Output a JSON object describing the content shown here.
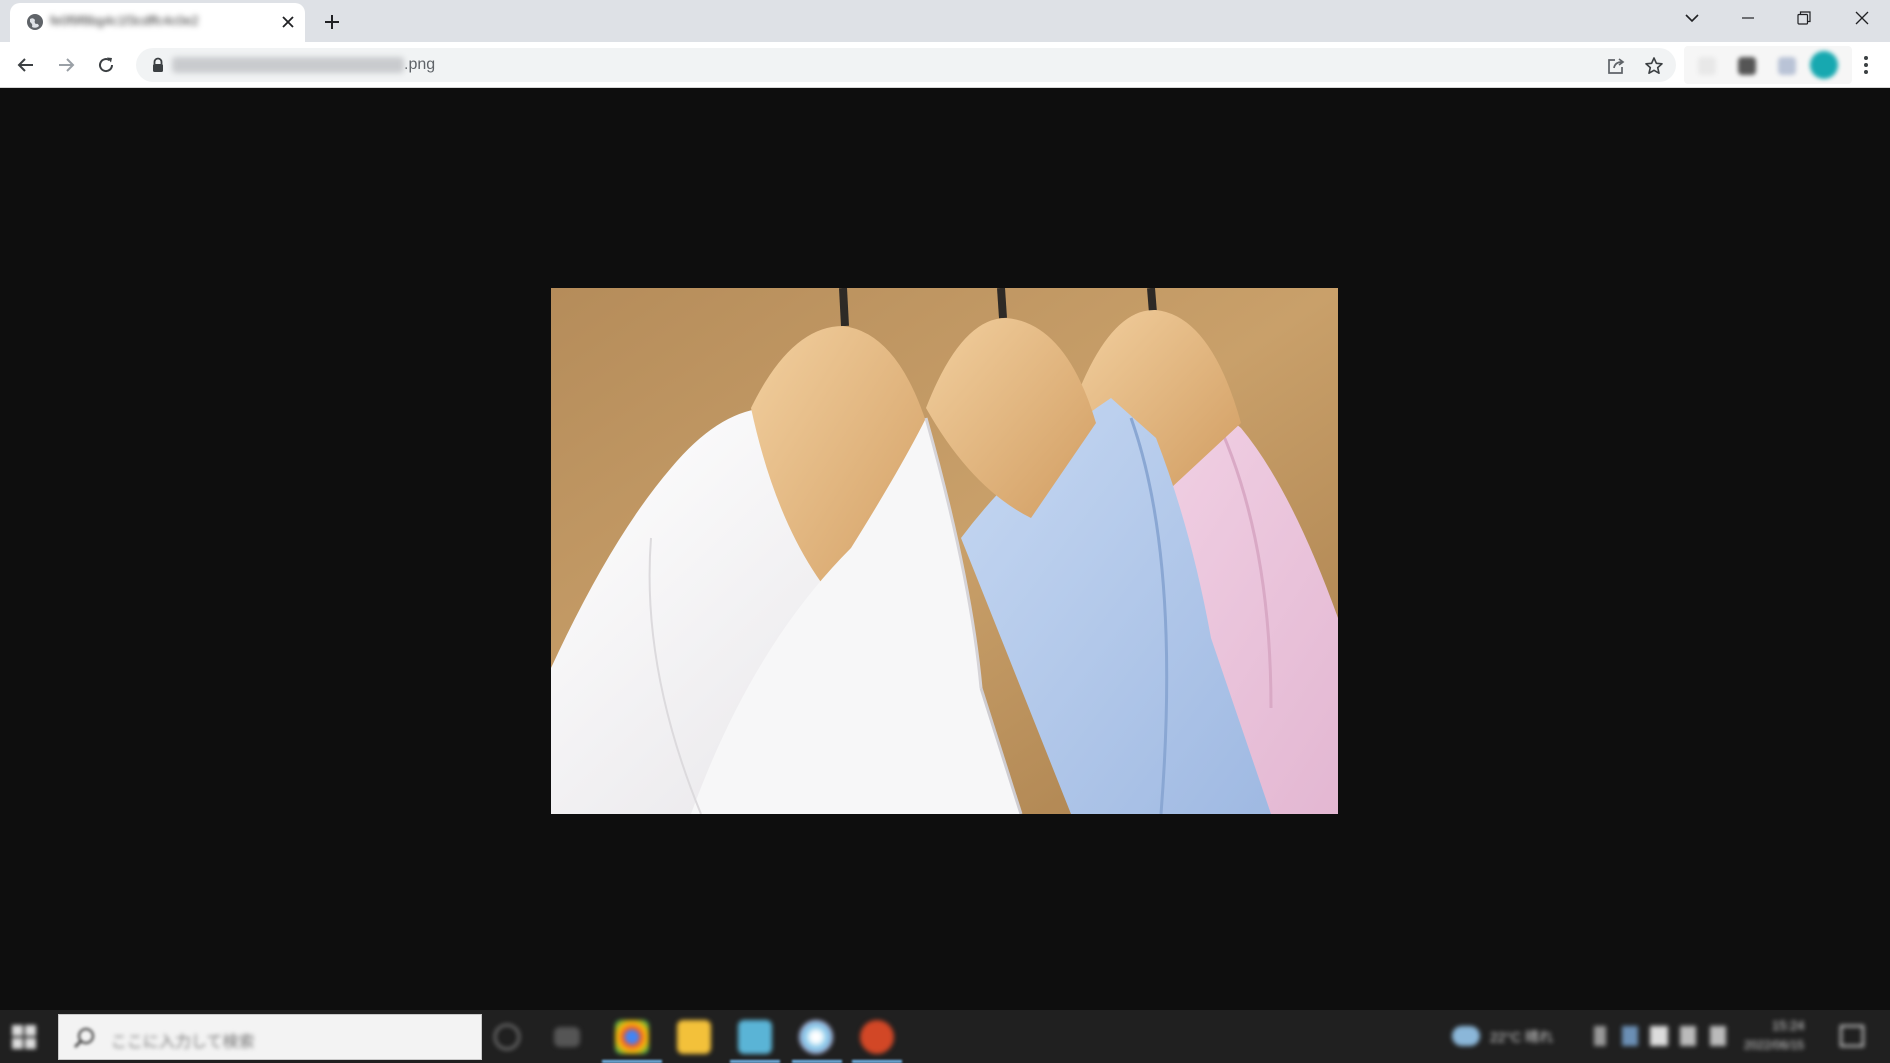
{
  "browser": {
    "tab": {
      "title": "fe0f9f8bg4c1f3cdffc4c0e2",
      "close_symbol": "✕"
    },
    "new_tab_symbol": "+",
    "window_controls": {
      "tab_search_icon": "chevron-down-icon",
      "minimize_icon": "minimize-icon",
      "restore_icon": "restore-icon",
      "close_icon": "close-icon"
    },
    "toolbar": {
      "back_icon": "back-arrow-icon",
      "forward_icon": "forward-arrow-icon",
      "reload_icon": "reload-icon",
      "address": {
        "blurred_part": "fe0f9f8bg4c1f3cdffc4c0e2",
        "visible_suffix": ".png"
      },
      "share_icon": "share-icon",
      "bookmark_icon": "star-icon",
      "menu_icon": "kebab-menu-icon"
    }
  },
  "viewer": {
    "image_alt": "Three dress shirts (white, light blue, pink) on wooden hangers",
    "background_color": "#0e0e0e"
  },
  "taskbar": {
    "search_placeholder": "ここに入力して検索",
    "pinned_apps": [
      "chrome",
      "file-explorer",
      "app-blue",
      "chrome-alt",
      "powerpoint"
    ],
    "weather": "22°C 晴れ",
    "clock_time": "15:24",
    "clock_date": "2022/06/15"
  }
}
